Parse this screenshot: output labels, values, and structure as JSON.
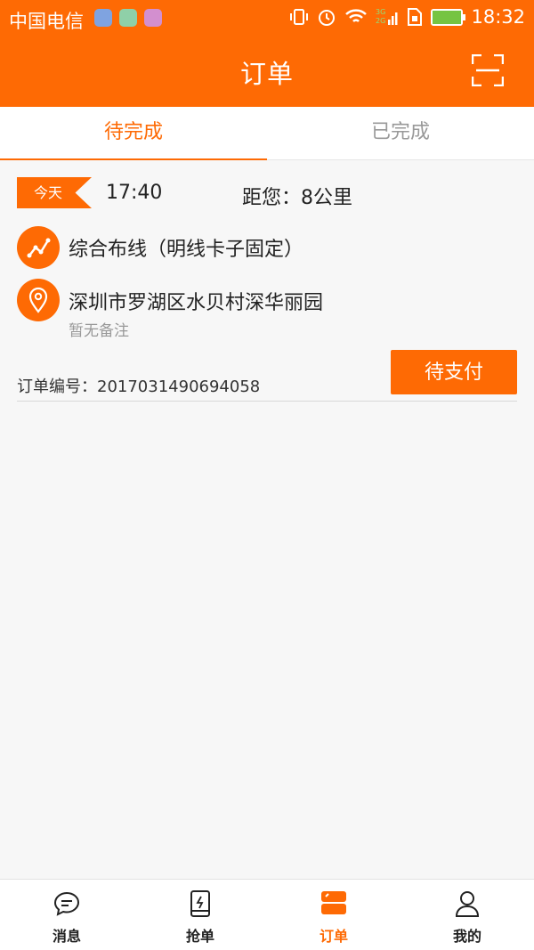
{
  "status_bar": {
    "carrier": "中国电信",
    "time": "18:32",
    "network": "3G 2G"
  },
  "header": {
    "title": "订单"
  },
  "tabs": [
    {
      "label": "待完成",
      "active": true
    },
    {
      "label": "已完成",
      "active": false
    }
  ],
  "order": {
    "day_tag": "今天",
    "time": "17:40",
    "distance": "距您：8公里",
    "service": "综合布线（明线卡子固定）",
    "address": "深圳市罗湖区水贝村深华丽园",
    "note": "暂无备注",
    "order_number": "订单编号：2017031490694058",
    "status_button": "待支付"
  },
  "bottom_nav": [
    {
      "label": "消息",
      "icon": "message-icon",
      "active": false
    },
    {
      "label": "抢单",
      "icon": "phone-icon",
      "active": false
    },
    {
      "label": "订单",
      "icon": "order-icon",
      "active": true
    },
    {
      "label": "我的",
      "icon": "profile-icon",
      "active": false
    }
  ],
  "colors": {
    "accent": "#fe6a04",
    "background": "#f7f7f7"
  }
}
